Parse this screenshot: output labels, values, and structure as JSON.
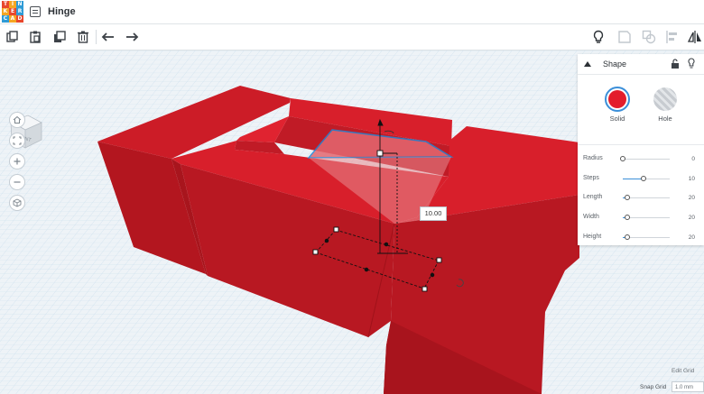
{
  "app": {
    "logo_letters": [
      "T",
      "I",
      "N",
      "K",
      "E",
      "R",
      "C",
      "A",
      "D"
    ],
    "logo_colors": [
      "#e8472c",
      "#f5a623",
      "#2f9bd6",
      "#f5a623",
      "#e8472c",
      "#2f9bd6",
      "#2f9bd6",
      "#f5a623",
      "#e8472c"
    ],
    "title": "Hinge"
  },
  "toolbar": {
    "left_icons": [
      "copy-icon",
      "paste-icon",
      "duplicate-icon",
      "trash-icon",
      "undo-icon",
      "redo-icon"
    ],
    "right_icons": [
      "lightbulb-icon",
      "note-icon",
      "group-icon",
      "align-icon",
      "mirror-icon"
    ]
  },
  "viewcube": {
    "label": "FRONT"
  },
  "nav_icons": [
    "home-icon",
    "fit-icon",
    "zoom-in-icon",
    "zoom-out-icon",
    "orthographic-icon"
  ],
  "shape_panel": {
    "title": "Shape",
    "solid_label": "Solid",
    "hole_label": "Hole",
    "solid_color": "#e31d2c",
    "properties": [
      {
        "label": "Radius",
        "value": "0",
        "level": 0.0
      },
      {
        "label": "Steps",
        "value": "10",
        "level": 0.45
      },
      {
        "label": "Length",
        "value": "20",
        "level": 0.1
      },
      {
        "label": "Width",
        "value": "20",
        "level": 0.1
      },
      {
        "label": "Height",
        "value": "20",
        "level": 0.1
      }
    ]
  },
  "dimension_tooltip": "10.00",
  "footer": {
    "edit_grid": "Edit Grid",
    "snap_grid_label": "Snap Grid",
    "snap_grid_value": "1.0 mm"
  },
  "colors": {
    "shape_red": "#e31d2c",
    "shape_dark": "#b81822",
    "grid_line": "#c4dceb"
  }
}
